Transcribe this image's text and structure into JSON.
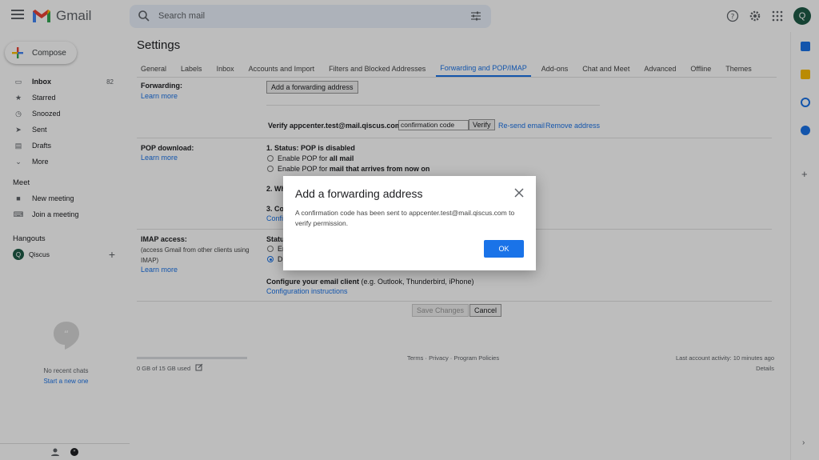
{
  "app": {
    "name": "Gmail",
    "avatar_letter": "Q"
  },
  "search": {
    "placeholder": "Search mail"
  },
  "sidebar": {
    "compose": "Compose",
    "items": [
      {
        "label": "Inbox",
        "count": "82",
        "icon": "inbox-icon"
      },
      {
        "label": "Starred",
        "count": "",
        "icon": "star-icon"
      },
      {
        "label": "Snoozed",
        "count": "",
        "icon": "clock-icon"
      },
      {
        "label": "Sent",
        "count": "",
        "icon": "send-icon"
      },
      {
        "label": "Drafts",
        "count": "",
        "icon": "draft-icon"
      },
      {
        "label": "More",
        "count": "",
        "icon": "chevron-down-icon"
      }
    ],
    "meet": {
      "title": "Meet",
      "new_meeting": "New meeting",
      "join_meeting": "Join a meeting"
    },
    "hangouts": {
      "title": "Hangouts",
      "user": "Qiscus",
      "avatar_letter": "Q"
    },
    "no_chats": "No recent chats",
    "start_new": "Start a new one"
  },
  "settings": {
    "title": "Settings",
    "tabs": [
      "General",
      "Labels",
      "Inbox",
      "Accounts and Import",
      "Filters and Blocked Addresses",
      "Forwarding and POP/IMAP",
      "Add-ons",
      "Chat and Meet",
      "Advanced",
      "Offline",
      "Themes"
    ],
    "active_tab": "Forwarding and POP/IMAP",
    "forwarding": {
      "label": "Forwarding:",
      "learn_more": "Learn more",
      "add_button": "Add a forwarding address",
      "verify_prefix": "Verify appcenter.test@mail.qiscus.com",
      "code_value": "confirmation code",
      "verify_button": "Verify",
      "resend": "Re-send email",
      "remove": "Remove address"
    },
    "pop": {
      "label": "POP download:",
      "learn_more": "Learn more",
      "status_prefix": "1. Status: ",
      "status_value": "POP is disabled",
      "opt1_prefix": "Enable POP for ",
      "opt1_bold": "all mail",
      "opt2_prefix": "Enable POP for ",
      "opt2_bold": "mail that arrives from now on",
      "step2_partial": "2. Wh",
      "step3_partial": "3. Co",
      "step3_link_partial": "Confi"
    },
    "imap": {
      "label": "IMAP access:",
      "sub_text": "(access Gmail from other clients using IMAP)",
      "learn_more": "Learn more",
      "status_partial": "Statu",
      "opt1_partial": "En",
      "opt2_partial": "Di",
      "configure_bold": "Configure your email client",
      "configure_rest": " (e.g. Outlook, Thunderbird, iPhone)",
      "config_link": "Configuration instructions"
    },
    "save_button": "Save Changes",
    "cancel_button": "Cancel"
  },
  "footer": {
    "storage": "0 GB of 15 GB used",
    "terms": "Terms",
    "privacy": "Privacy",
    "policies": "Program Policies",
    "sep": "·",
    "last_activity": "Last account activity: 10 minutes ago",
    "details": "Details"
  },
  "dialog": {
    "title": "Add a forwarding address",
    "body": "A confirmation code has been sent to appcenter.test@mail.qiscus.com to verify permission.",
    "ok": "OK"
  },
  "colors": {
    "accent": "#1a73e8",
    "avatar": "#1e5b47"
  }
}
